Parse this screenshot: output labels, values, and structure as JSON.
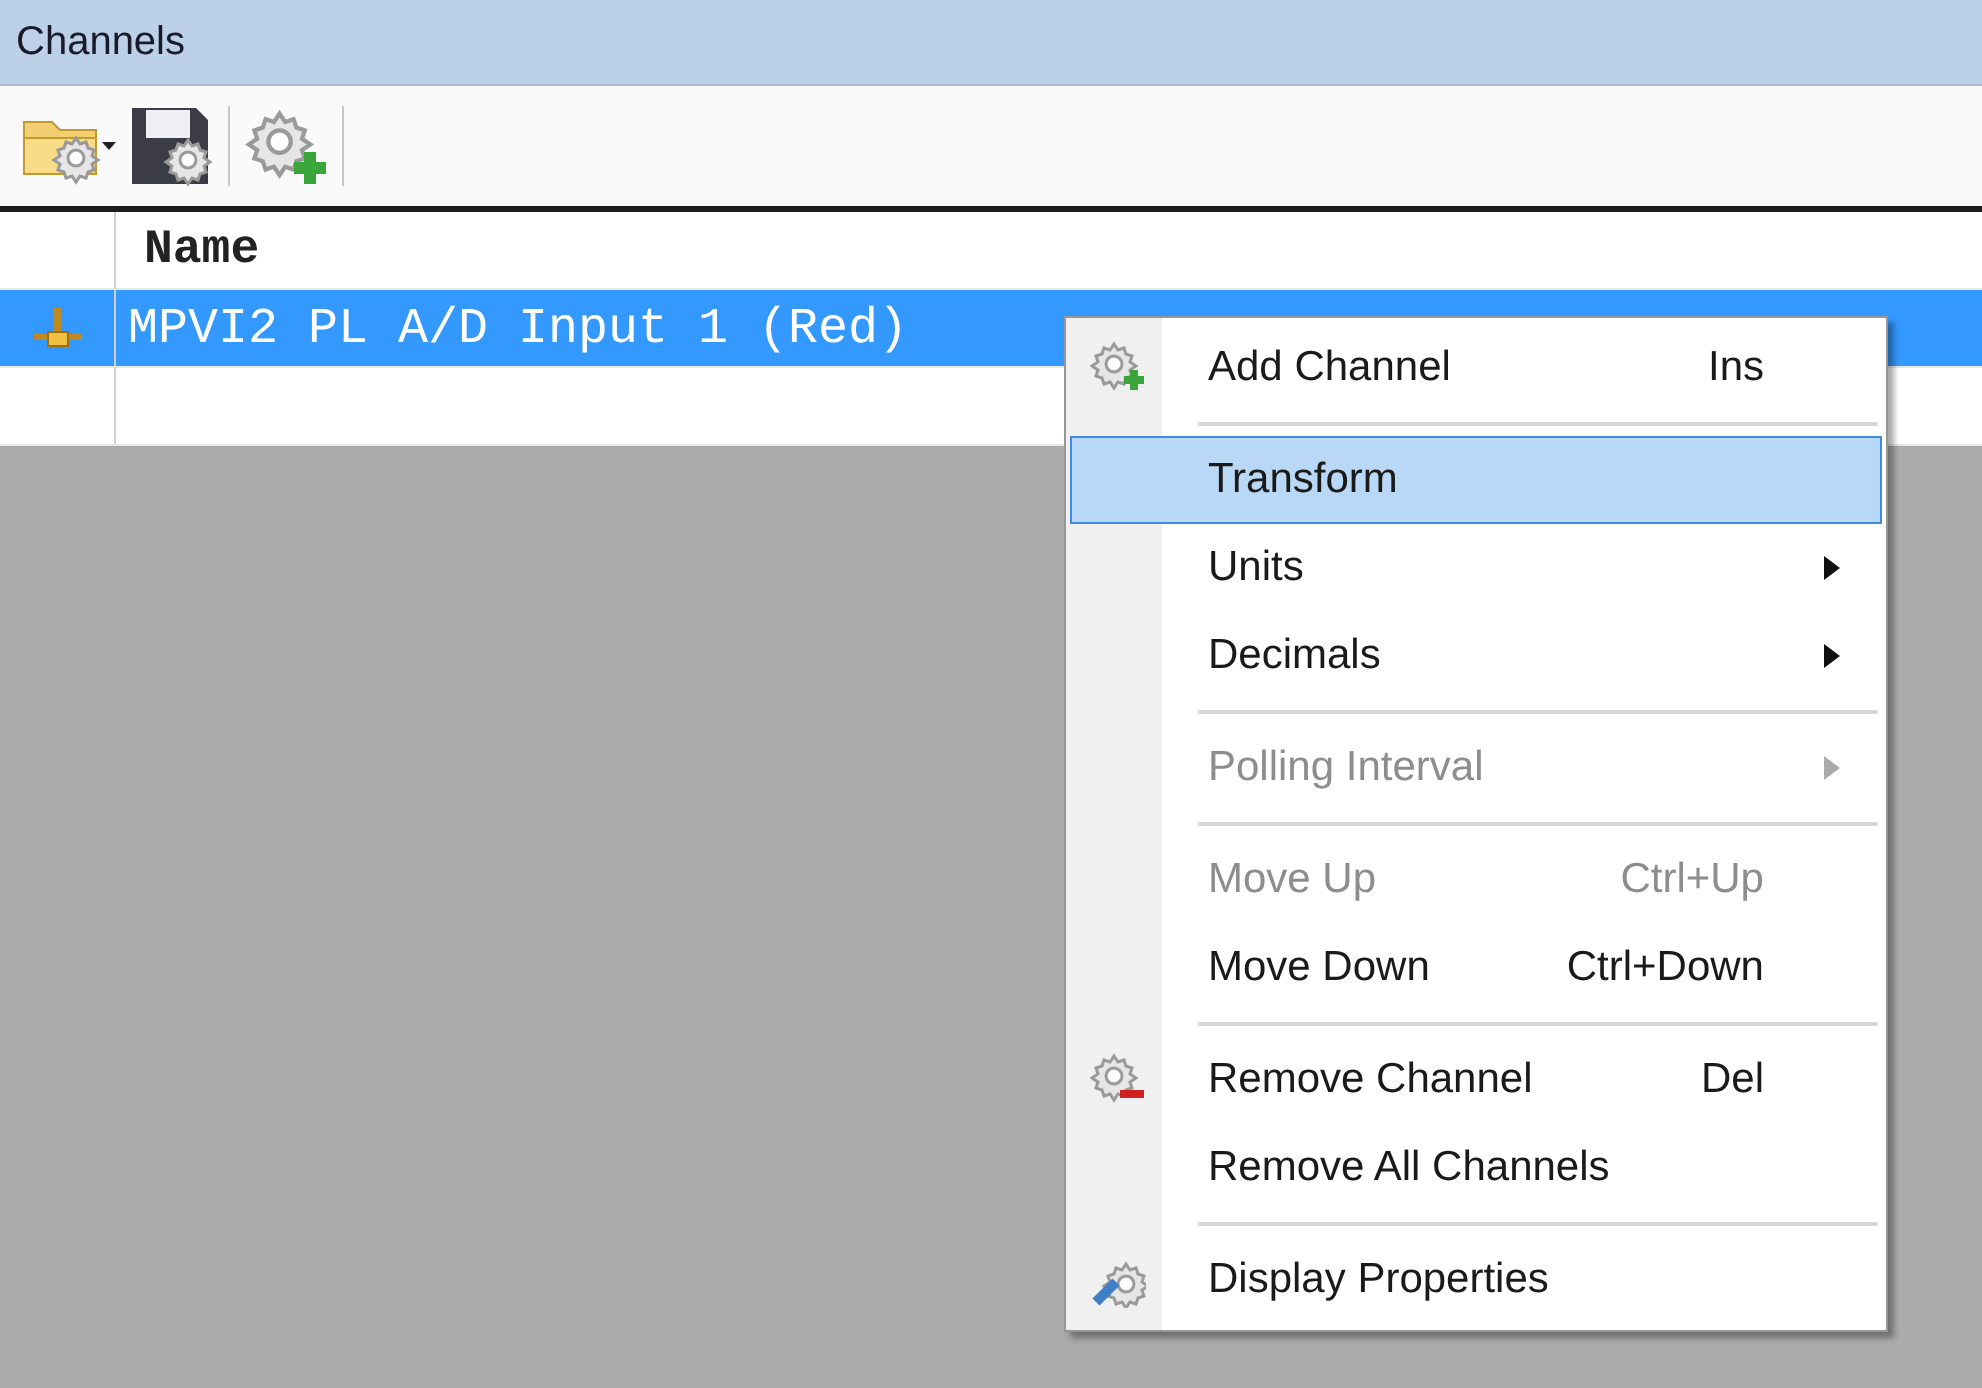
{
  "panel": {
    "title": "Channels"
  },
  "table": {
    "columns": [
      "Name"
    ],
    "rows": [
      {
        "name": "MPVI2 PL A/D Input 1 (Red)",
        "selected": true
      }
    ]
  },
  "context_menu": {
    "items": [
      {
        "kind": "item",
        "label": "Add Channel",
        "shortcut": "Ins",
        "submenu": false,
        "disabled": false,
        "selected": false
      },
      {
        "kind": "separator"
      },
      {
        "kind": "item",
        "label": "Transform",
        "submenu": false,
        "disabled": false,
        "selected": true
      },
      {
        "kind": "item",
        "label": "Units",
        "submenu": true,
        "disabled": false,
        "selected": false
      },
      {
        "kind": "item",
        "label": "Decimals",
        "submenu": true,
        "disabled": false,
        "selected": false
      },
      {
        "kind": "separator"
      },
      {
        "kind": "item",
        "label": "Polling Interval",
        "submenu": true,
        "disabled": true,
        "selected": false
      },
      {
        "kind": "separator"
      },
      {
        "kind": "item",
        "label": "Move Up",
        "shortcut": "Ctrl+Up",
        "submenu": false,
        "disabled": true,
        "selected": false
      },
      {
        "kind": "item",
        "label": "Move Down",
        "shortcut": "Ctrl+Down",
        "submenu": false,
        "disabled": false,
        "selected": false
      },
      {
        "kind": "separator"
      },
      {
        "kind": "item",
        "label": "Remove Channel",
        "shortcut": "Del",
        "submenu": false,
        "disabled": false,
        "selected": false
      },
      {
        "kind": "item",
        "label": "Remove All Channels",
        "submenu": false,
        "disabled": false,
        "selected": false
      },
      {
        "kind": "separator"
      },
      {
        "kind": "item",
        "label": "Display Properties",
        "submenu": false,
        "disabled": false,
        "selected": false
      }
    ]
  }
}
